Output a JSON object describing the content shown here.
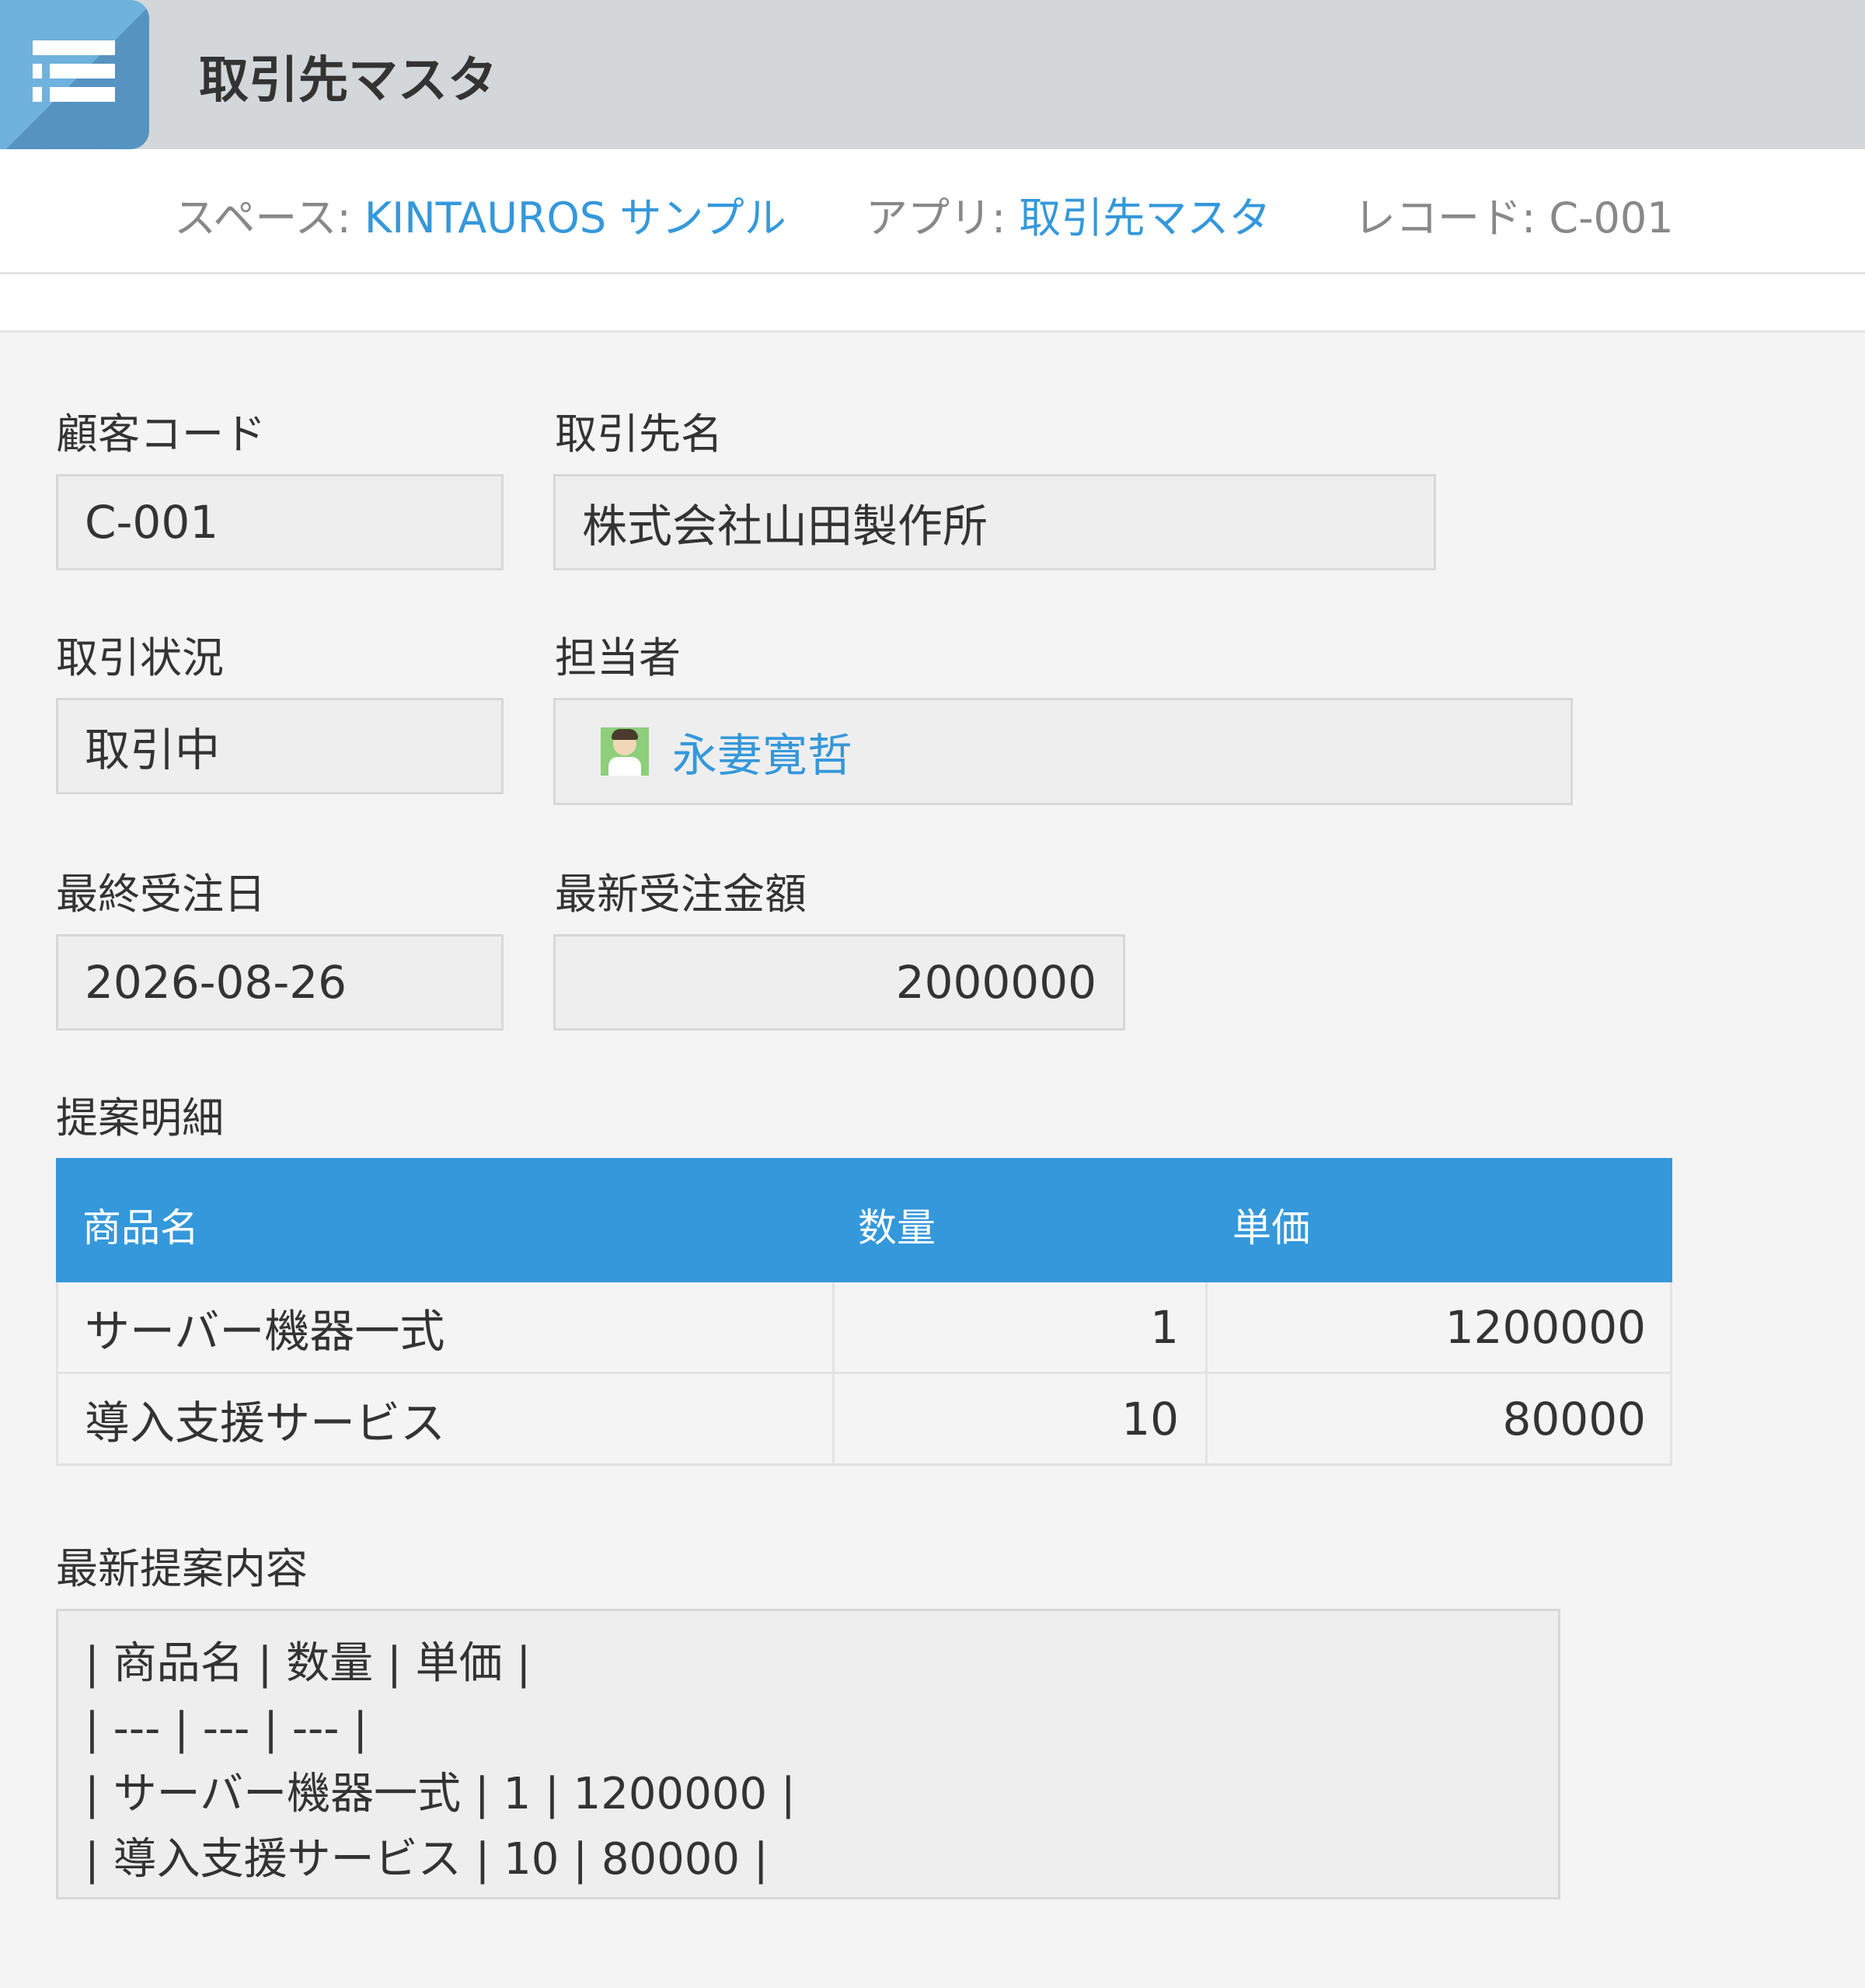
{
  "header": {
    "app_icon": "list-icon",
    "app_title": "取引先マスタ"
  },
  "breadcrumb": {
    "space_label": "スペース: ",
    "space_value": "KINTAUROS サンプル",
    "app_label": "アプリ: ",
    "app_value": "取引先マスタ",
    "record_label": "レコード: ",
    "record_value": "C-001"
  },
  "fields": {
    "customer_code": {
      "label": "顧客コード",
      "value": "C-001"
    },
    "company_name": {
      "label": "取引先名",
      "value": "株式会社山田製作所"
    },
    "deal_status": {
      "label": "取引状況",
      "value": "取引中"
    },
    "assignee": {
      "label": "担当者",
      "value": "永妻寛哲",
      "avatar_icon": "user-avatar-icon"
    },
    "last_order_date": {
      "label": "最終受注日",
      "value": "2026-08-26"
    },
    "latest_order_amount": {
      "label": "最新受注金額",
      "value": "2000000"
    }
  },
  "proposal_table": {
    "label": "提案明細",
    "headers": [
      "商品名",
      "数量",
      "単価"
    ],
    "rows": [
      [
        "サーバー機器一式",
        "1",
        "1200000"
      ],
      [
        "導入支援サービス",
        "10",
        "80000"
      ]
    ]
  },
  "latest_proposal": {
    "label": "最新提案内容",
    "lines": [
      "| 商品名 | 数量 | 単価 |",
      "| --- | --- | --- |",
      "| サーバー機器一式 | 1 | 1200000 |",
      "| 導入支援サービス | 10 | 80000 |"
    ]
  },
  "colors": {
    "accent": "#3498db",
    "header_bg": "#d3d7d9",
    "field_bg": "#eeeeee",
    "page_bg": "#f4f4f4"
  }
}
